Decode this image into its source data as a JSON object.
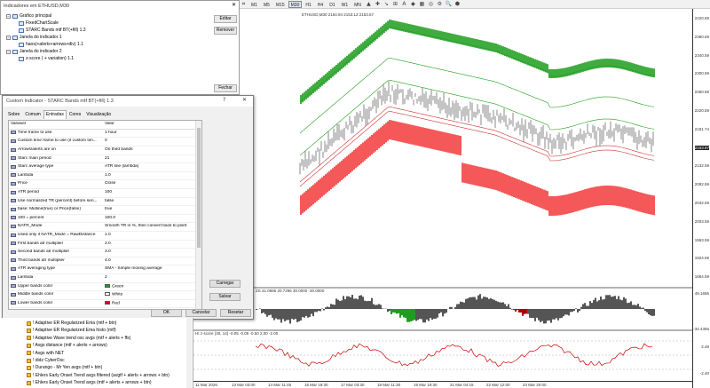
{
  "toolbar": {
    "timeframes": [
      "M1",
      "M5",
      "M15",
      "M30",
      "H1",
      "H4",
      "D1",
      "W1",
      "MN"
    ],
    "active_timeframe": "M30"
  },
  "chart": {
    "ohlc_label": "ETHUSD,M30 2154.94 2153.12 2153.67",
    "price_labels": [
      "2420.59",
      "2380.59",
      "2340.59",
      "2300.59",
      "2260.59",
      "2220.59",
      "2181.74",
      "2153.67",
      "2132.59",
      "2092.59",
      "2042.59",
      "2003.59",
      "1963.59",
      "1924.59",
      "1884.59"
    ],
    "current_price": "2153.67",
    "osc1_label": "ZS 41.0656 20.7296 30.0000 -30.0000",
    "osc1_scale": [
      "49.1656",
      "-34.4356"
    ],
    "osc2_label": "HI z-score (30, 14) -0.05 -0.05 -0.50 2.00 -2.00",
    "osc2_scale": [
      "2.48",
      "-2.40"
    ],
    "time_labels": [
      "11 Mar 2026",
      "13 Mar 03:00",
      "14 Mar 11:45",
      "15 Mar 19:30",
      "17 Mar 03:30",
      "18 Mar 11:30",
      "19 Mar 19:30",
      "21 Mar 04:15",
      "22 Mar 12:00",
      "23 Mar 20:00"
    ],
    "colors": {
      "upper": "#1e9e1e",
      "lower": "#f02020",
      "candles": "#8a8a8a"
    }
  },
  "navigator": {
    "title": "Indicadores em ETHUSD,M30",
    "items": [
      {
        "label": "Gráfico principal"
      },
      {
        "label": "FixedChartScale"
      },
      {
        "label": "STARC Bands mtf BT(+fill) 1.3"
      },
      {
        "label": "Janela do indicador 1"
      },
      {
        "label": "haos(+alerts+arrows+div) 1.1"
      },
      {
        "label": "Janela do indicador 2"
      },
      {
        "label": "z-score ( + variation) 1.1"
      }
    ],
    "edit_label": "Editar",
    "remove_label": "Remover",
    "close_label": "Fechar"
  },
  "dialog": {
    "title": "Custom Indicator - STARC Bands mtf BT(+fill) 1.3",
    "help": "?",
    "close": "✕",
    "tabs": [
      "Sobre",
      "Comum",
      "Entradas",
      "Cores",
      "Visualização"
    ],
    "active_tab": "Entradas",
    "col_variable": "Variável",
    "col_value": "Valor",
    "rows": [
      {
        "var": "Time frame to use",
        "val": "1 hour"
      },
      {
        "var": "Custom time frame to use (if custom tim...",
        "val": "0"
      },
      {
        "var": "Arrows/alerts are on",
        "val": "On third bands"
      },
      {
        "var": "Starc main period",
        "val": "21"
      },
      {
        "var": "Starc average type",
        "val": "ATR line (lambda)"
      },
      {
        "var": "Lambda",
        "val": "1.0"
      },
      {
        "var": "Price",
        "val": "Close"
      },
      {
        "var": "ATR period",
        "val": "100"
      },
      {
        "var": "Use normalized TR (percent) before sen...",
        "val": "false"
      },
      {
        "var": "base: Midline(true) or Price(false)",
        "val": "true"
      },
      {
        "var": "100 = percent",
        "val": "100.0"
      },
      {
        "var": "NATR_Mode",
        "val": "Smooth TR in %, then convert back to point"
      },
      {
        "var": "Used only if NATR_Mode = RawDistance",
        "val": "1.0"
      },
      {
        "var": "First bands atr multiplier",
        "val": "2.0"
      },
      {
        "var": "Second bands atr multiplier",
        "val": "3.0"
      },
      {
        "var": "Third bands atr multiplier",
        "val": "4.0"
      },
      {
        "var": "ATR averaging type",
        "val": "SMA - Simple moving average"
      },
      {
        "var": "Lambda",
        "val": "2"
      },
      {
        "var": "Upper bands color",
        "val": "Green"
      },
      {
        "var": "Middle bands color",
        "val": "White"
      },
      {
        "var": "Lower bands color",
        "val": "Red"
      }
    ],
    "swatches": {
      "Green": "#1e9e1e",
      "White": "#ffffff",
      "Red": "#e00000"
    },
    "load_label": "Carregar",
    "save_label": "Salvar",
    "ok_label": "OK",
    "cancel_label": "Cancelar",
    "reset_label": "Resetar"
  },
  "indicator_list": [
    "! Adaptive ER Regularized Ema (mtf + btn)",
    "! Adaptive ER Regularized Ema histo (mtf)",
    "! Adaptive Wave trend osc avgs (mtf + alerts + ffs)",
    "! Avgs distance (mtf + alerts + arrows)",
    "! Avgs with NET",
    "! didz CyberOsc",
    "! Durango - Mr Yen avgs (mtf + btn)",
    "! Ehlers Early Onset Trend avgs filtered (avgtf + alerts + arrows + btn)",
    "! Ehlers Early Onset Trend avgs (mtf + alerts + arrows + btn)"
  ]
}
